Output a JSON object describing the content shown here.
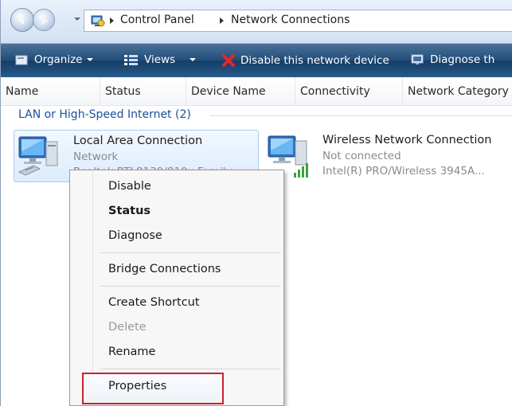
{
  "address_bar": {
    "breadcrumbs": [
      "Control Panel",
      "Network Connections"
    ]
  },
  "toolbar": {
    "organize": "Organize",
    "views": "Views",
    "disable": "Disable this network device",
    "diagnose": "Diagnose th"
  },
  "columns": [
    "Name",
    "Status",
    "Device Name",
    "Connectivity",
    "Network Category"
  ],
  "group": {
    "label": "LAN or High-Speed Internet (2)"
  },
  "connections": [
    {
      "name": "Local Area Connection",
      "status": "Network",
      "device": "Realtek RTL8139/810x Family"
    },
    {
      "name": "Wireless Network Connection",
      "status": "Not connected",
      "device": "Intel(R) PRO/Wireless 3945A..."
    }
  ],
  "context_menu": {
    "disable": "Disable",
    "status": "Status",
    "diagnose": "Diagnose",
    "bridge": "Bridge Connections",
    "shortcut": "Create Shortcut",
    "delete": "Delete",
    "rename": "Rename",
    "properties": "Properties"
  },
  "colors": {
    "toolbar": "#1f4c79",
    "group_text": "#1b4f9a",
    "selection_border": "#a7cdf0",
    "highlight_box": "#cc2229"
  }
}
